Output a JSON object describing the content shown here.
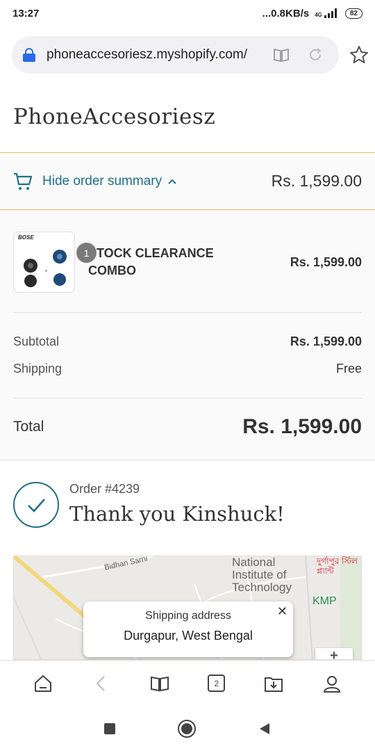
{
  "status": {
    "time": "13:27",
    "network": "...0.8KB/s",
    "signal": "4G",
    "battery": "82"
  },
  "browser": {
    "url": "phoneaccesoriesz.myshopify.com/",
    "tab_count": "2"
  },
  "store": {
    "name": "PhoneAccesoriesz"
  },
  "summary_toggle": {
    "label": "Hide order summary",
    "total": "Rs. 1,599.00"
  },
  "product": {
    "quantity": "1",
    "name": "STOCK CLEARANCE COMBO",
    "price": "Rs. 1,599.00",
    "thumb_brand": "BOSE"
  },
  "totals": {
    "subtotal_label": "Subtotal",
    "subtotal_value": "Rs. 1,599.00",
    "shipping_label": "Shipping",
    "shipping_value": "Free",
    "total_label": "Total",
    "total_value": "Rs. 1,599.00"
  },
  "confirmation": {
    "order_number": "Order #4239",
    "heading": "Thank you Kinshuck!"
  },
  "map": {
    "labels": [
      "Bidhan Sarni",
      "National Institute of Technology",
      "KMP",
      "দুর্গাপুর স্টিল প্ল্যান্ট"
    ],
    "tooltip_title": "Shipping address",
    "tooltip_address": "Durgapur, West Bengal"
  },
  "colors": {
    "accent": "#1f6f86",
    "toggle_border": "#e0b96a",
    "lock": "#2a6ae8"
  }
}
